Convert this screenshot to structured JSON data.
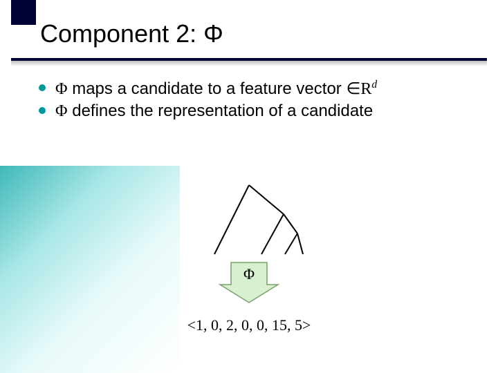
{
  "title": "Component 2: Φ",
  "bullets": [
    {
      "prefix": "Φ",
      "text": " maps a candidate to a feature vector ",
      "tail_sym": "∈",
      "tail_set": "R",
      "tail_exp": "d"
    },
    {
      "prefix": "Φ",
      "text": " defines the representation of a candidate",
      "tail_sym": "",
      "tail_set": "",
      "tail_exp": ""
    }
  ],
  "arrow_label": "Φ",
  "vector": "<1, 0, 2, 0, 0, 15, 5>"
}
